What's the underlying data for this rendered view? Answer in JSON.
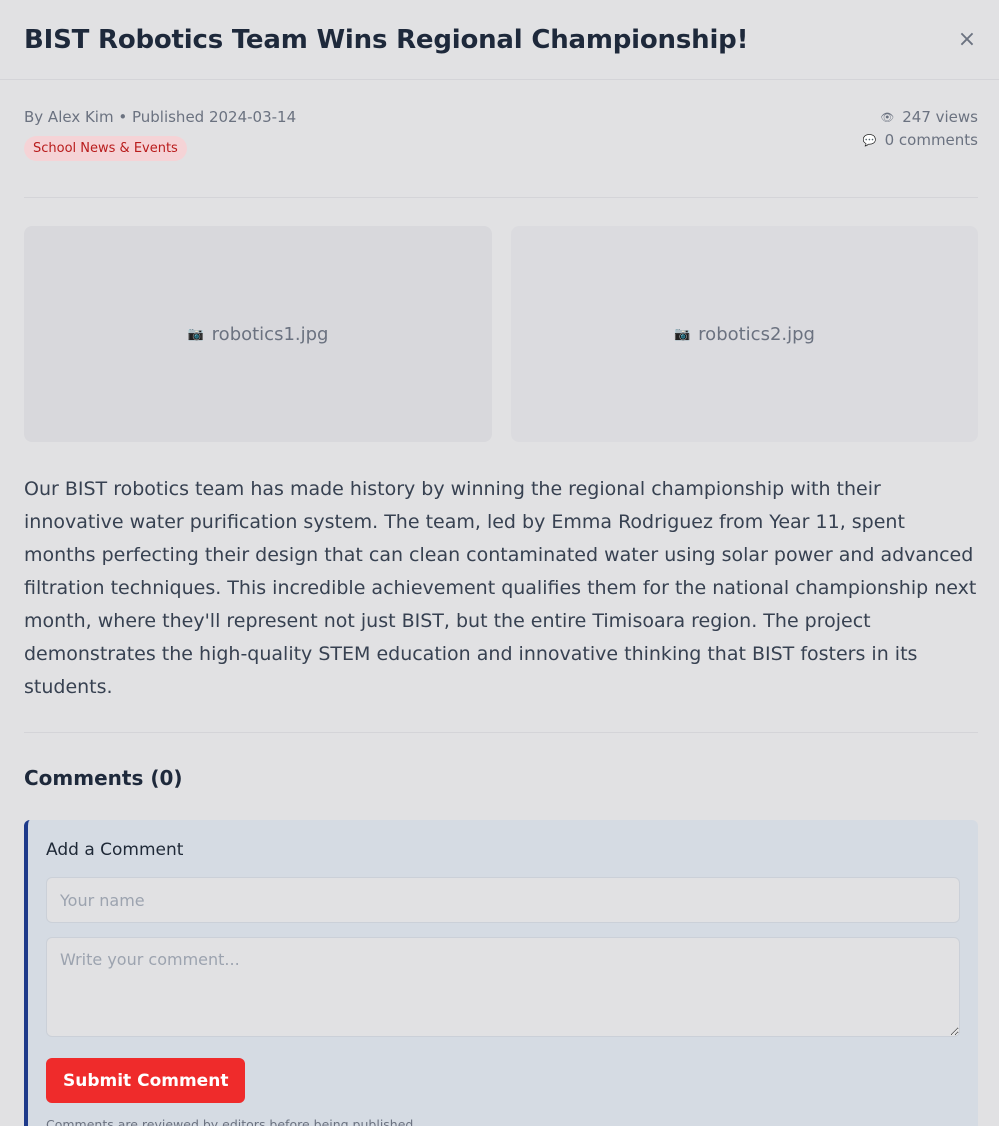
{
  "modal": {
    "title": "BIST Robotics Team Wins Regional Championship!",
    "close_glyph": "×"
  },
  "meta": {
    "byline": "By Alex Kim • Published 2024-03-14",
    "category": "School News & Events",
    "views_icon": "eye-icon",
    "views_glyph": "👁",
    "views": "247 views",
    "comments_icon": "speech-bubble-icon",
    "comments_glyph": "💬",
    "comments": "0 comments"
  },
  "images": [
    {
      "icon": "camera-icon",
      "glyph": "📷",
      "filename": "robotics1.jpg"
    },
    {
      "icon": "camera-icon",
      "glyph": "📷",
      "filename": "robotics2.jpg"
    }
  ],
  "article": {
    "body": "Our BIST robotics team has made history by winning the regional championship with their innovative water purification system. The team, led by Emma Rodriguez from Year 11, spent months perfecting their design that can clean contaminated water using solar power and advanced filtration techniques. This incredible achievement qualifies them for the national championship next month, where they'll represent not just BIST, but the entire Timisoara region. The project demonstrates the high-quality STEM education and innovative thinking that BIST fosters in its students."
  },
  "comments": {
    "heading": "Comments (0)",
    "form": {
      "title": "Add a Comment",
      "name_placeholder": "Your name",
      "comment_placeholder": "Write your comment...",
      "submit_label": "Submit Comment",
      "note": "Comments are reviewed by editors before being published."
    }
  },
  "colors": {
    "accent": "#ef2b2b",
    "form_border": "#1e3a8a",
    "badge_bg": "#f5d3d6",
    "badge_text": "#b91c1c"
  }
}
